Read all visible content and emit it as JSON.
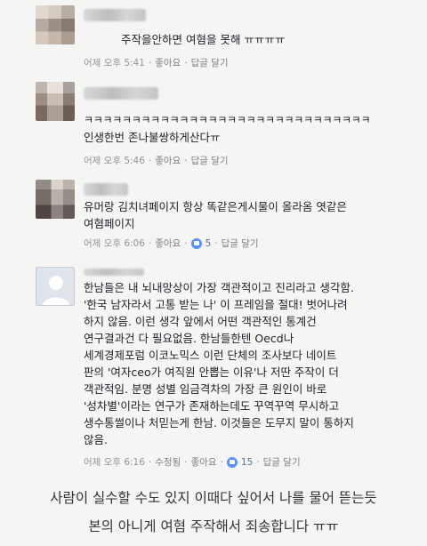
{
  "comments": [
    {
      "text": "주작을안하면 여혐을 못해 ㅠㅠㅠㅠ",
      "time": "어제 오후 5:41",
      "like_label": "좋아요",
      "reply_label": "답글 달기"
    },
    {
      "text_lines": [
        "ㅋㅋㅋㅋㅋㅋㅋㅋㅋㅋㅋㅋㅋㅋㅋㅋㅋㅋㅋㅋㅋㅋㅋㅋㅋㅋㅋㅋㅋㅋ",
        "인생한번 존나불쌍하게산다ㅠ"
      ],
      "time": "어제 오후 5:46",
      "like_label": "좋아요",
      "reply_label": "답글 달기"
    },
    {
      "text_lines": [
        "유머랑 김치녀페이지 항상 똑같은게시물이 올라옴 엿같은",
        "여혐페이지"
      ],
      "time": "어제 오후 6:06",
      "like_label": "좋아요",
      "like_count": "5",
      "reply_label": "답글 달기"
    },
    {
      "text_lines": [
        "한남들은 내 뇌내망상이 가장 객관적이고 진리라고 생각함.",
        "'한국 남자라서 고통 받는 나' 이 프레임을 절대! 벗어나려",
        "하지 않음. 이런 생각 앞에서 어떤 객관적인 통계건",
        "연구결과건 다 필요없음. 한남들한텐 Oecd나",
        "세계경제포럼 이코노믹스 이런 단체의 조사보다 네이트",
        "판의 '여자ceo가 여직원 안뽑는 이유'나 저딴 주작이 더",
        "객관적임. 분명 성별 임금격차의 가장 큰 원인이 바로",
        "'성차별'이라는 연구가 존재하는데도 꾸역꾸역 무시하고",
        "생수통썰이나 처믿는게 한남. 이것들은 도무지 말이 통하지",
        "않음."
      ],
      "time": "어제 오후 6:16",
      "edited_label": "수정됨",
      "like_label": "좋아요",
      "like_count": "15",
      "reply_label": "답글 달기"
    }
  ],
  "caption": {
    "line1": "사람이 실수할 수도 있지 이때다 싶어서 나를 물어 뜯는듯",
    "line2": "본의 아니게 여혐 주작해서 죄송합니다 ㅠㅠ"
  },
  "colors": {
    "meta": "#90949c",
    "like_icon": "#5890ff",
    "background": "#f5f5f4"
  }
}
